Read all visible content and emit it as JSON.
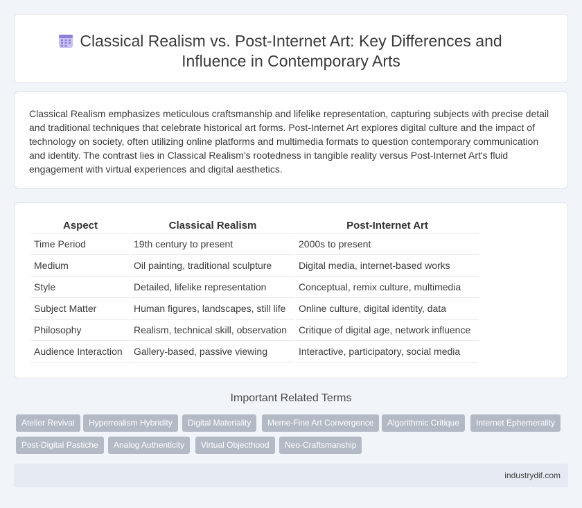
{
  "header": {
    "title_line1": "Classical Realism vs. Post-Internet Art: Key Differences and",
    "title_line2": "Influence in Contemporary Arts",
    "icon": "calendar-grid-icon"
  },
  "intro": {
    "text": "Classical Realism emphasizes meticulous craftsmanship and lifelike representation, capturing subjects with precise detail and traditional techniques that celebrate historical art forms. Post-Internet Art explores digital culture and the impact of technology on society, often utilizing online platforms and multimedia formats to question contemporary communication and identity. The contrast lies in Classical Realism's rootedness in tangible reality versus Post-Internet Art's fluid engagement with virtual experiences and digital aesthetics."
  },
  "table": {
    "headers": [
      "Aspect",
      "Classical Realism",
      "Post-Internet Art"
    ],
    "rows": [
      [
        "Time Period",
        "19th century to present",
        "2000s to present"
      ],
      [
        "Medium",
        "Oil painting, traditional sculpture",
        "Digital media, internet-based works"
      ],
      [
        "Style",
        "Detailed, lifelike representation",
        "Conceptual, remix culture, multimedia"
      ],
      [
        "Subject Matter",
        "Human figures, landscapes, still life",
        "Online culture, digital identity, data"
      ],
      [
        "Philosophy",
        "Realism, technical skill, observation",
        "Critique of digital age, network influence"
      ],
      [
        "Audience Interaction",
        "Gallery-based, passive viewing",
        "Interactive, participatory, social media"
      ]
    ]
  },
  "related": {
    "title": "Important Related Terms",
    "tags": [
      "Atelier Revival",
      "Hyperrealism Hybridity",
      "Digital Materiality",
      "Meme-Fine Art Convergence",
      "Algorithmic Critique",
      "Internet Ephemerality",
      "Post-Digital Pastiche",
      "Analog Authenticity",
      "Virtual Objecthood",
      "Neo-Craftsmanship"
    ]
  },
  "footer": {
    "text": "industrydif.com"
  },
  "colors": {
    "background": "#f1f4f9",
    "tag_bg": "#b3bac6",
    "footer_bg": "#e6eaf3",
    "icon_accent": "#8f7fd8"
  }
}
